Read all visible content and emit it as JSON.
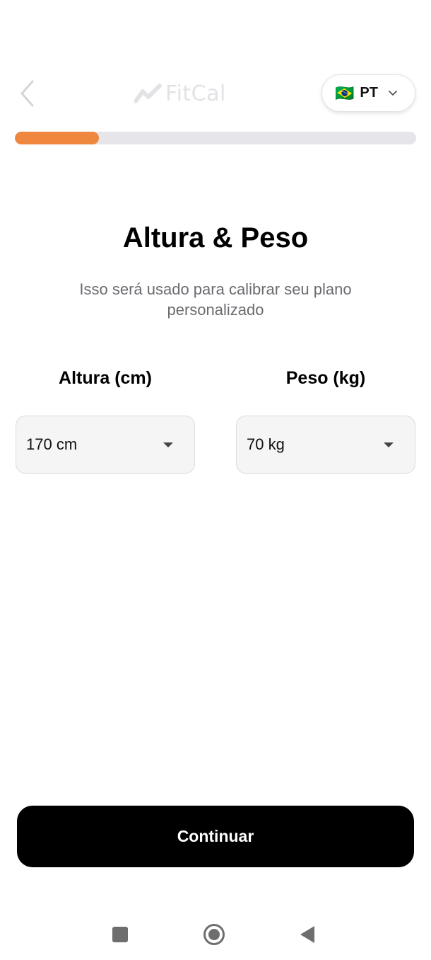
{
  "header": {
    "app_name": "FitCal",
    "language": {
      "code": "PT",
      "flag": "🇧🇷"
    }
  },
  "progress": {
    "fraction": 0.21
  },
  "main": {
    "title": "Altura & Peso",
    "subtitle": "Isso será usado para calibrar seu plano personalizado",
    "height_field": {
      "label": "Altura (cm)",
      "value": "170 cm"
    },
    "weight_field": {
      "label": "Peso (kg)",
      "value": "70 kg"
    }
  },
  "footer": {
    "continue_label": "Continuar"
  },
  "colors": {
    "accent": "#f0873f",
    "button_bg": "#000000",
    "track": "#e6e6ea"
  },
  "icons": {
    "back": "chevron-left-icon",
    "logo": "trend-line-icon",
    "dropdown": "chevron-down-icon",
    "select_caret": "caret-down-icon",
    "nav_recents": "square-icon",
    "nav_home": "circle-icon",
    "nav_back": "triangle-left-icon"
  }
}
